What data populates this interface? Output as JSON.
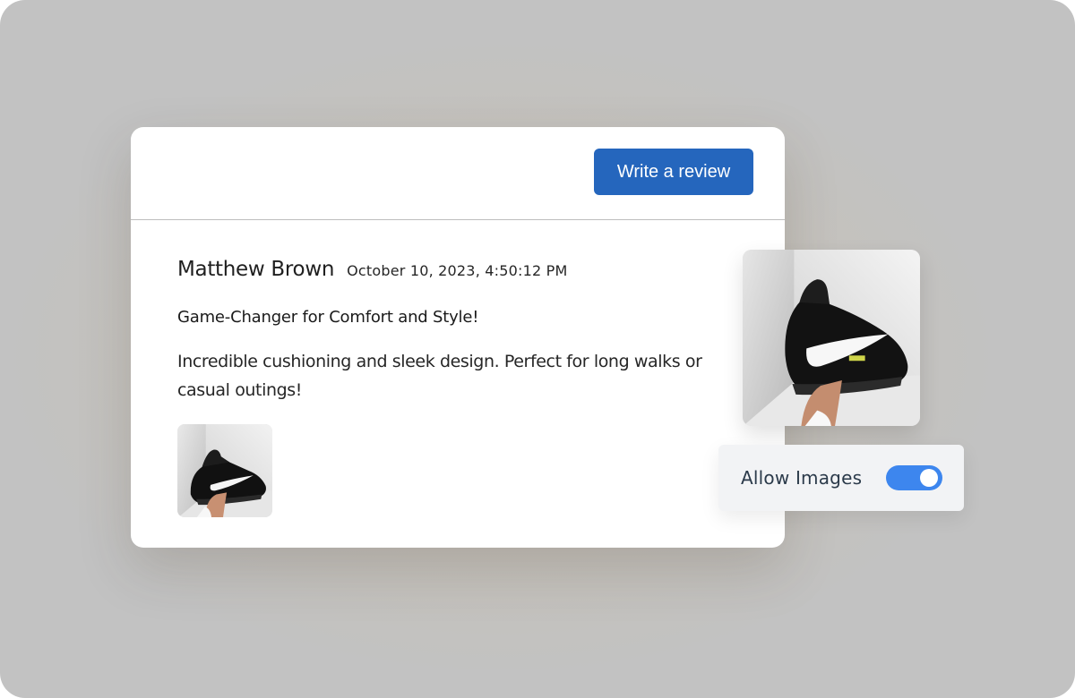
{
  "header": {
    "write_review_label": "Write a review"
  },
  "review": {
    "reviewer_name": "Matthew Brown",
    "date": "October 10, 2023, 4:50:12 PM",
    "title": "Game-Changer for Comfort and Style!",
    "body": "Incredible cushioning and sleek design. Perfect for long walks or casual outings!",
    "attachment_icon": "sneaker-photo"
  },
  "preview": {
    "image_icon": "sneaker-photo"
  },
  "settings": {
    "allow_images_label": "Allow Images",
    "allow_images_enabled": true
  },
  "colors": {
    "primary_button": "#2566bd",
    "toggle_on": "#3d86ee",
    "panel_bg": "#f2f3f5",
    "label_text": "#2b3a4a"
  }
}
